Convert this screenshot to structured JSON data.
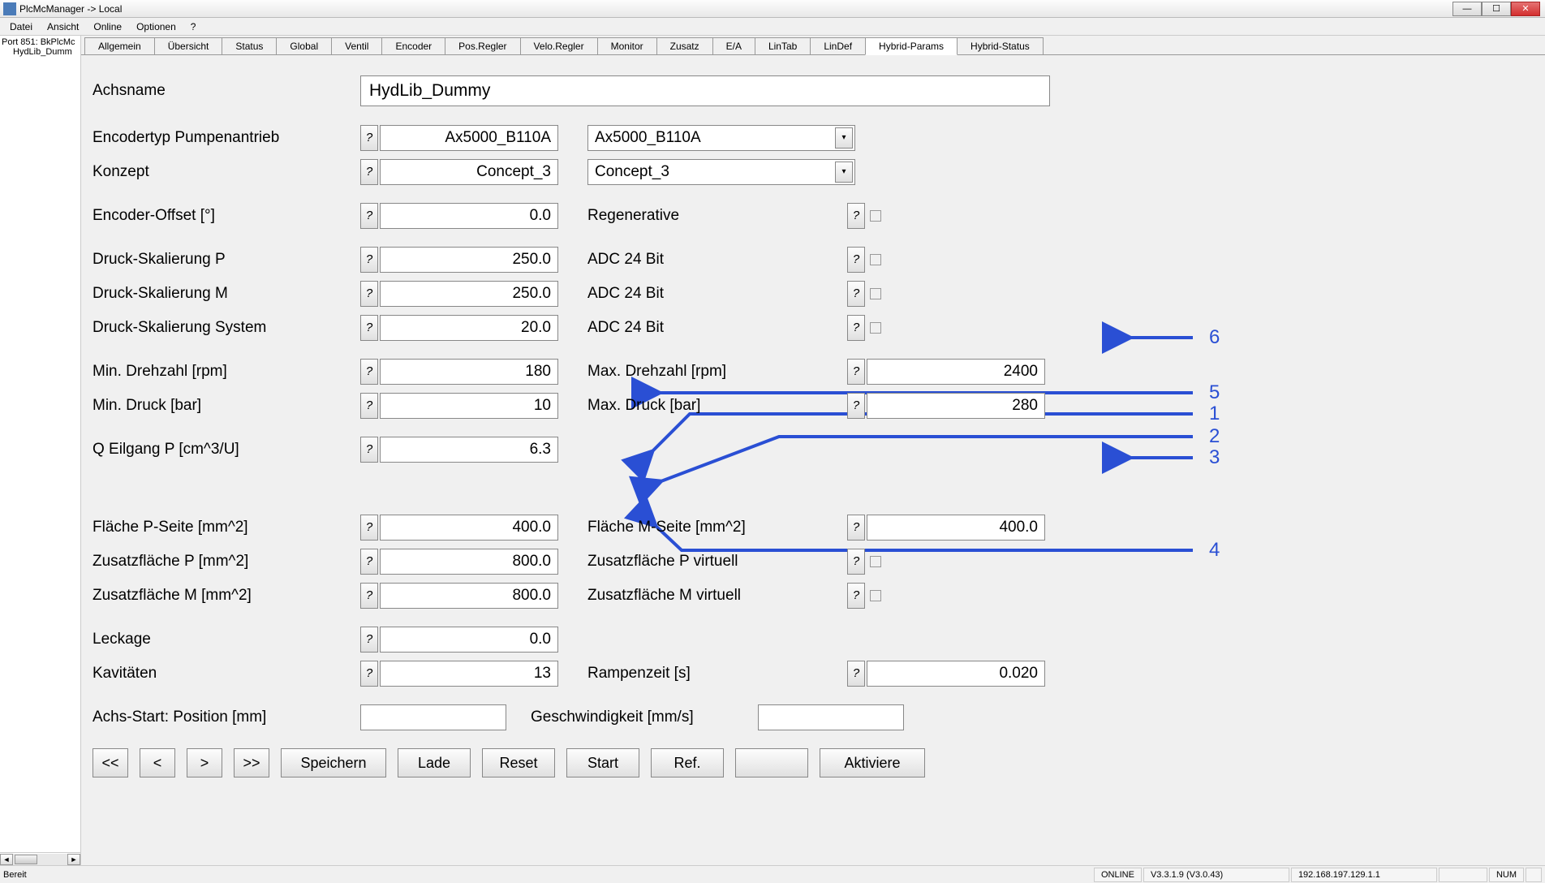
{
  "window": {
    "title": "PlcMcManager -> Local"
  },
  "menu": {
    "datei": "Datei",
    "ansicht": "Ansicht",
    "online": "Online",
    "optionen": "Optionen",
    "help": "?"
  },
  "side": {
    "line1": "Port 851: BkPlcMc",
    "line2": "HydLib_Dumm"
  },
  "tabs": [
    "Allgemein",
    "Übersicht",
    "Status",
    "Global",
    "Ventil",
    "Encoder",
    "Pos.Regler",
    "Velo.Regler",
    "Monitor",
    "Zusatz",
    "E/A",
    "LinTab",
    "LinDef",
    "Hybrid-Params",
    "Hybrid-Status"
  ],
  "active_tab": 13,
  "form": {
    "achsname_label": "Achsname",
    "achsname_value": "HydLib_Dummy",
    "encodertyp_label": "Encodertyp Pumpenantrieb",
    "encodertyp_value": "Ax5000_B110A",
    "encodertyp_dd": "Ax5000_B110A",
    "konzept_label": "Konzept",
    "konzept_value": "Concept_3",
    "konzept_dd": "Concept_3",
    "enc_offset_label": "Encoder-Offset [°]",
    "enc_offset_value": "0.0",
    "regen_label": "Regenerative",
    "druck_p_label": "Druck-Skalierung P",
    "druck_p_value": "250.0",
    "adc_p_label": "ADC 24 Bit",
    "druck_m_label": "Druck-Skalierung M",
    "druck_m_value": "250.0",
    "adc_m_label": "ADC 24 Bit",
    "druck_sys_label": "Druck-Skalierung System",
    "druck_sys_value": "20.0",
    "adc_sys_label": "ADC 24 Bit",
    "min_drehzahl_label": "Min. Drehzahl [rpm]",
    "min_drehzahl_value": "180",
    "max_drehzahl_label": "Max. Drehzahl [rpm]",
    "max_drehzahl_value": "2400",
    "min_druck_label": "Min. Druck [bar]",
    "min_druck_value": "10",
    "max_druck_label": "Max. Druck [bar]",
    "max_druck_value": "280",
    "q_eilgang_label": "Q Eilgang P [cm^3/U]",
    "q_eilgang_value": "6.3",
    "flaeche_p_label": "Fläche P-Seite [mm^2]",
    "flaeche_p_value": "400.0",
    "flaeche_m_label": "Fläche M-Seite [mm^2]",
    "flaeche_m_value": "400.0",
    "zusatz_p_label": "Zusatzfläche P [mm^2]",
    "zusatz_p_value": "800.0",
    "zusatz_p_virt_label": "Zusatzfläche P virtuell",
    "zusatz_m_label": "Zusatzfläche M [mm^2]",
    "zusatz_m_value": "800.0",
    "zusatz_m_virt_label": "Zusatzfläche M virtuell",
    "leckage_label": "Leckage",
    "leckage_value": "0.0",
    "kavitaeten_label": "Kavitäten",
    "kavitaeten_value": "13",
    "rampenzeit_label": "Rampenzeit [s]",
    "rampenzeit_value": "0.020",
    "achs_start_label": "Achs-Start: Position [mm]",
    "geschw_label": "Geschwindigkeit [mm/s]"
  },
  "buttons": {
    "first": "<<",
    "prev": "<",
    "next": ">",
    "last": ">>",
    "speichern": "Speichern",
    "lade": "Lade",
    "reset": "Reset",
    "start": "Start",
    "ref": "Ref.",
    "blank": "",
    "aktiviere": "Aktiviere"
  },
  "status": {
    "bereit": "Bereit",
    "online": "ONLINE",
    "version": "V3.3.1.9 (V3.0.43)",
    "ip": "192.168.197.129.1.1",
    "num": "NUM"
  },
  "help_char": "?",
  "annotations": {
    "n1": "1",
    "n2": "2",
    "n3": "3",
    "n4": "4",
    "n5": "5",
    "n6": "6"
  }
}
